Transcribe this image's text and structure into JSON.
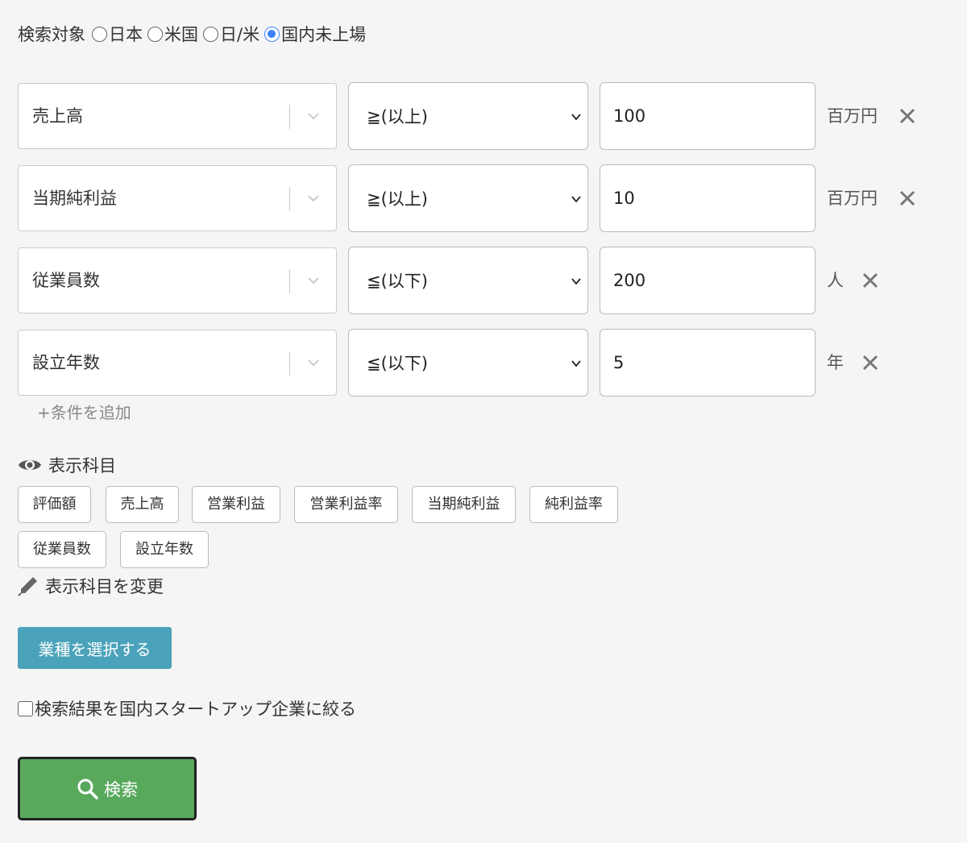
{
  "search_target": {
    "label": "検索対象",
    "options": [
      {
        "label": "日本",
        "checked": false
      },
      {
        "label": "米国",
        "checked": false
      },
      {
        "label": "日/米",
        "checked": false
      },
      {
        "label": "国内未上場",
        "checked": true
      }
    ]
  },
  "conditions": [
    {
      "field": "売上高",
      "operator": "≧(以上)",
      "value": "100",
      "unit": "百万円"
    },
    {
      "field": "当期純利益",
      "operator": "≧(以上)",
      "value": "10",
      "unit": "百万円"
    },
    {
      "field": "従業員数",
      "operator": "≦(以下)",
      "value": "200",
      "unit": "人"
    },
    {
      "field": "設立年数",
      "operator": "≦(以下)",
      "value": "5",
      "unit": "年"
    }
  ],
  "add_condition_label": "+条件を追加",
  "display_items": {
    "heading": "表示科目",
    "tags": [
      "評価額",
      "売上高",
      "営業利益",
      "営業利益率",
      "当期純利益",
      "純利益率",
      "従業員数",
      "設立年数"
    ],
    "change_label": "表示科目を変更"
  },
  "industry_button_label": "業種を選択する",
  "startup_filter": {
    "label": "検索結果を国内スタートアップ企業に絞る",
    "checked": false
  },
  "search_button_label": "検索",
  "colors": {
    "industry_button": "#4aa3ba",
    "search_button": "#59a95d",
    "radio_checked": "#3b82f6"
  }
}
